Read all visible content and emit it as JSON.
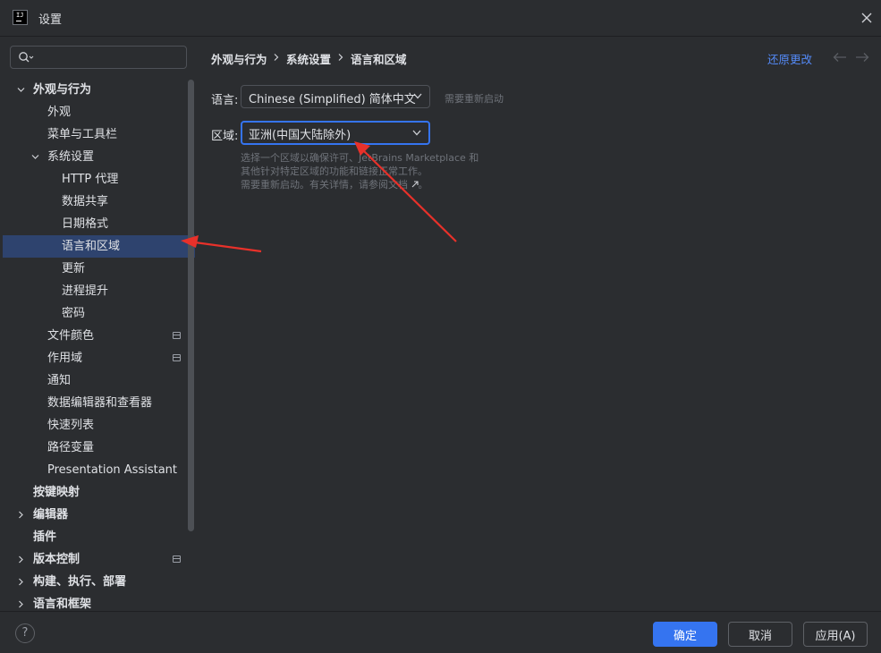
{
  "window": {
    "title": "设置"
  },
  "sidebar": {
    "search": {
      "value": "",
      "placeholder": ""
    },
    "items": [
      {
        "label": "外观与行为",
        "bold": true,
        "expanded": true
      },
      {
        "label": "外观"
      },
      {
        "label": "菜单与工具栏"
      },
      {
        "label": "系统设置",
        "expanded": true
      },
      {
        "label": "HTTP 代理"
      },
      {
        "label": "数据共享"
      },
      {
        "label": "日期格式"
      },
      {
        "label": "语言和区域",
        "selected": true
      },
      {
        "label": "更新"
      },
      {
        "label": "进程提升"
      },
      {
        "label": "密码"
      },
      {
        "label": "文件颜色",
        "badge": "project-icon"
      },
      {
        "label": "作用域",
        "badge": "project-icon"
      },
      {
        "label": "通知"
      },
      {
        "label": "数据编辑器和查看器"
      },
      {
        "label": "快速列表"
      },
      {
        "label": "路径变量"
      },
      {
        "label": "Presentation Assistant"
      },
      {
        "label": "按键映射",
        "bold": true
      },
      {
        "label": "编辑器",
        "bold": true,
        "expanded": false
      },
      {
        "label": "插件",
        "bold": true
      },
      {
        "label": "版本控制",
        "bold": true,
        "expanded": false,
        "badge": "project-icon"
      },
      {
        "label": "构建、执行、部署",
        "bold": true,
        "expanded": false
      },
      {
        "label": "语言和框架",
        "bold": true,
        "expanded": false
      }
    ]
  },
  "breadcrumb": [
    "外观与行为",
    "系统设置",
    "语言和区域"
  ],
  "header": {
    "revert_label": "还原更改"
  },
  "language": {
    "label": "语言:",
    "value": "Chinese (Simplified) 简体中文",
    "hint": "需要重新启动"
  },
  "region": {
    "label": "区域:",
    "value": "亚洲(中国大陆除外)",
    "desc_line1": "选择一个区域以确保许可、JetBrains Marketplace 和",
    "desc_line2": "其他针对特定区域的功能和链接正常工作。",
    "desc_line3_prefix": "需要重新启动。有关详情，请参阅",
    "desc_link": "文档",
    "desc_line3_suffix": "。"
  },
  "footer": {
    "help_label": "?",
    "ok_label": "确定",
    "cancel_label": "取消",
    "apply_label": "应用(A)"
  },
  "colors": {
    "background": "#2b2d30",
    "selection": "#2e436e",
    "accent": "#3574f0",
    "link": "#548af7",
    "annotation_arrow": "#e8312a"
  }
}
